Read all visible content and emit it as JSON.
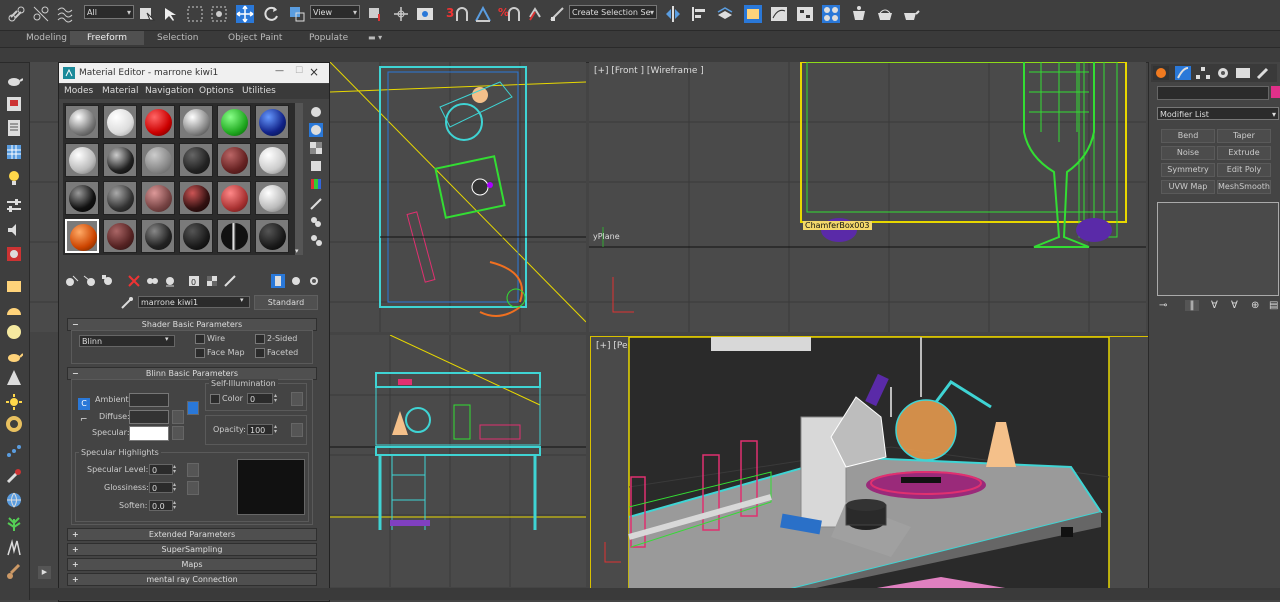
{
  "toolbar": {
    "selection_filter": "All",
    "reference_coord": "View",
    "named_selection": "Create Selection Se",
    "snap_3": "3",
    "snap_pct": "%"
  },
  "ribbon": {
    "tabs": [
      "Modeling",
      "Freeform",
      "Selection",
      "Object Paint",
      "Populate"
    ],
    "active_tab": "Freeform"
  },
  "viewports": {
    "front_label": "[+] [Front ] [Wireframe ]",
    "persp_label": "[+] [Perspective] [Realistic]",
    "yplane_label": "yPlane",
    "object_tag": "ChamferBox003"
  },
  "material_editor": {
    "title": "Material Editor - marrone kiwi1",
    "menu": [
      "Modes",
      "Material",
      "Navigation",
      "Options",
      "Utilities"
    ],
    "material_name": "marrone kiwi1",
    "material_type": "Standard",
    "shader_rollout": "Shader Basic Parameters",
    "shader": "Blinn",
    "wire": "Wire",
    "two_sided": "2-Sided",
    "face_map": "Face Map",
    "faceted": "Faceted",
    "blinn_rollout": "Blinn Basic Parameters",
    "self_illum": "Self-Illumination",
    "color_label": "Color",
    "color_value": "0",
    "ambient": "Ambient:",
    "diffuse": "Diffuse:",
    "specular": "Specular:",
    "opacity_label": "Opacity:",
    "opacity_value": "100",
    "spec_highlights": "Specular Highlights",
    "spec_level": "Specular Level:",
    "spec_level_value": "0",
    "glossiness": "Glossiness:",
    "glossiness_value": "0",
    "soften": "Soften:",
    "soften_value": "0.0",
    "rollouts": [
      "Extended Parameters",
      "SuperSampling",
      "Maps",
      "mental ray Connection"
    ],
    "lock_letter": "C"
  },
  "command_panel": {
    "modifier_list": "Modifier List",
    "buttons": [
      "Bend",
      "Taper",
      "Noise",
      "Extrude",
      "Symmetry",
      "Edit Poly",
      "UVW Map",
      "MeshSmooth"
    ],
    "accent_color": "#e0308a"
  },
  "colors": {
    "viewport_bg": "#4a4a4a",
    "wire_cyan": "#3fd4d4",
    "wire_green": "#33dd33",
    "wire_yellow": "#e8d800",
    "highlight_blue": "#2a78d8"
  }
}
